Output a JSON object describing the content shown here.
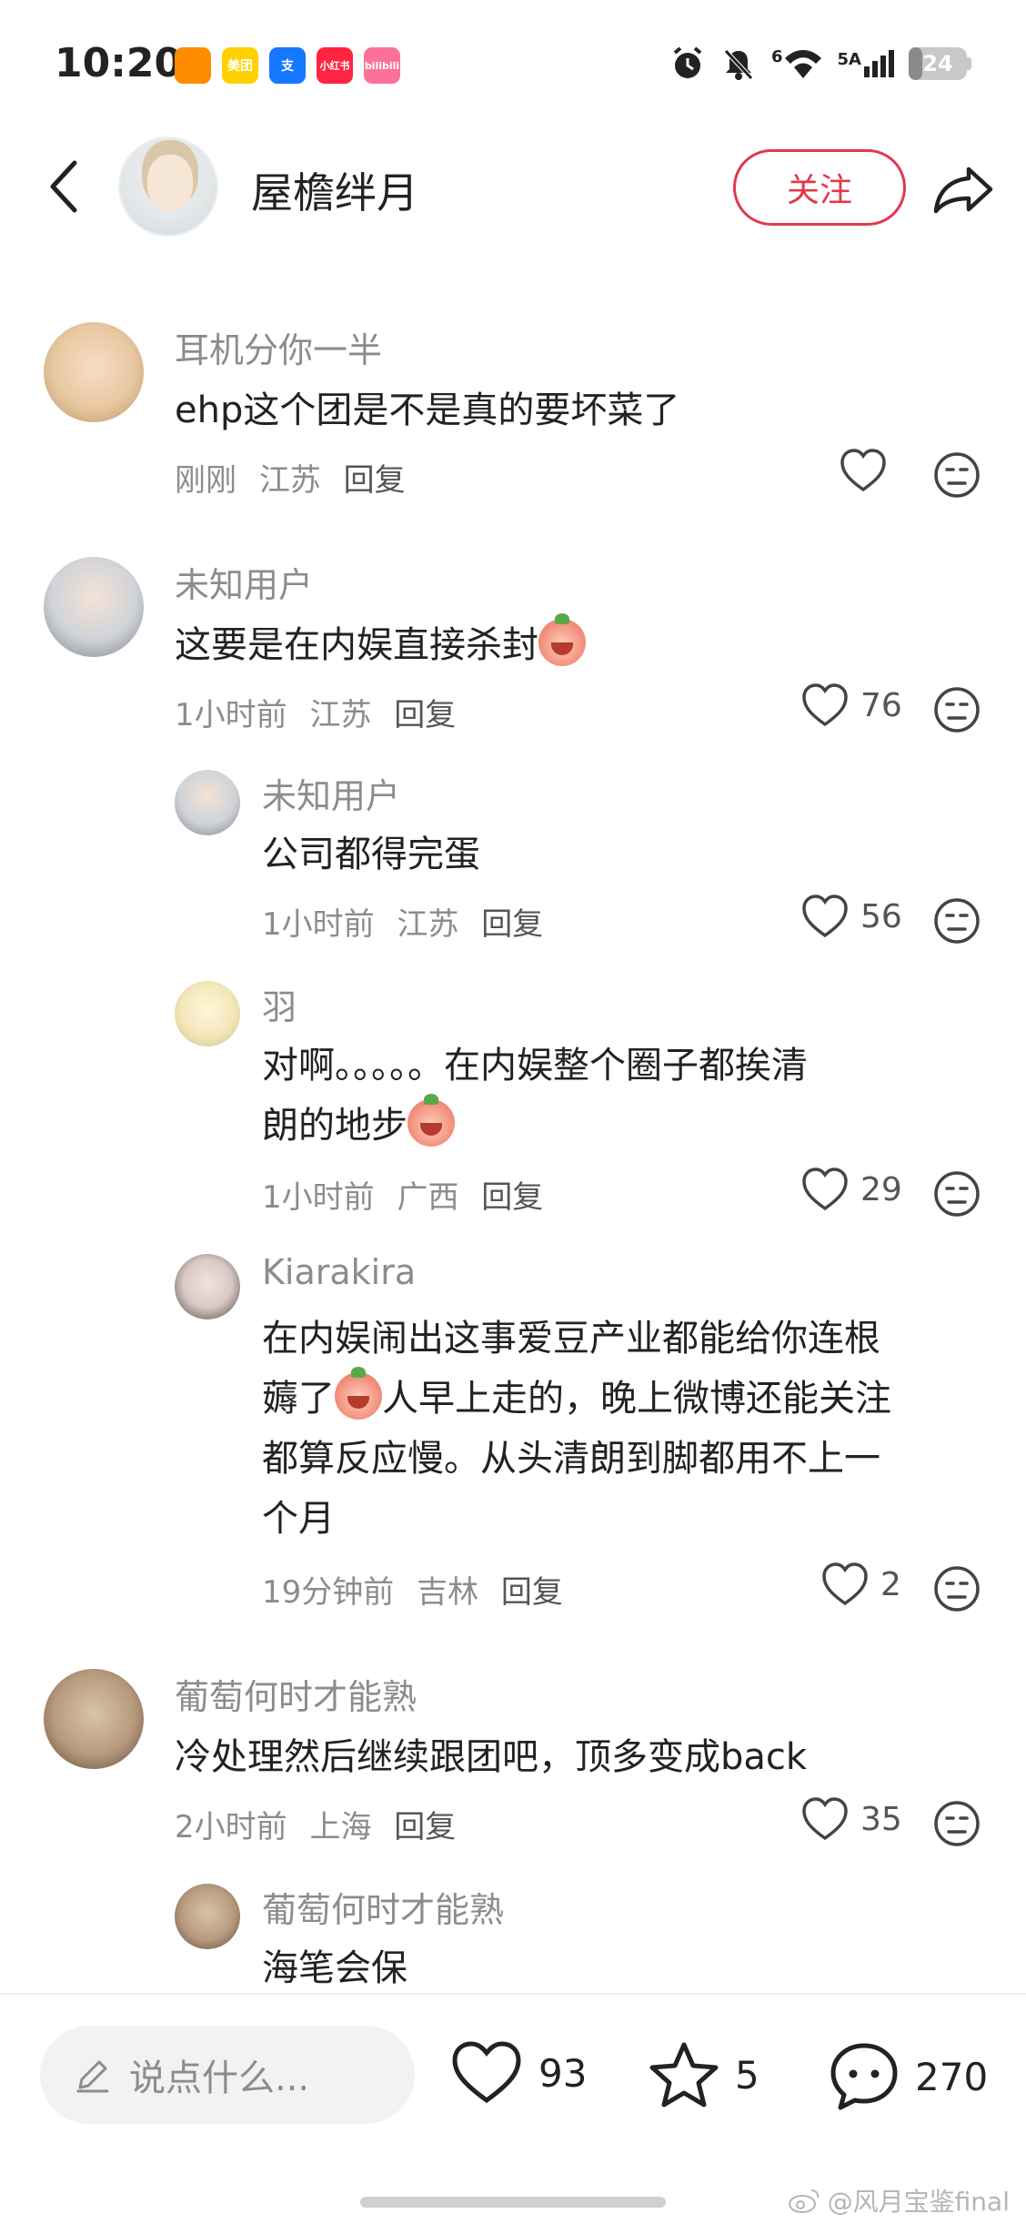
{
  "status_bar": {
    "time": "10:20",
    "network": "5A",
    "signal_prefix": "6",
    "battery": "24",
    "battery_level": 0.24,
    "apps": [
      {
        "name": "weibo-icon",
        "color": "#ff8c00",
        "label": ""
      },
      {
        "name": "meituan-icon",
        "color": "#ffd100",
        "label": "美团"
      },
      {
        "name": "alipay-icon",
        "color": "#1677ff",
        "label": "支"
      },
      {
        "name": "xiaohongshu-icon",
        "color": "#ff2442",
        "label": "小红书"
      },
      {
        "name": "bilibili-icon",
        "color": "#fb7299",
        "label": "bilibili"
      }
    ]
  },
  "header": {
    "author_name": "屋檐绊月",
    "follow_label": "关注"
  },
  "comments": [
    {
      "id": "c1",
      "username": "耳机分你一半",
      "text": "ehp这个团是不是真的要坏菜了",
      "time": "刚刚",
      "location": "江苏",
      "reply_label": "回复",
      "likes": "",
      "avatar_color": "#e9c8a0"
    },
    {
      "id": "c2",
      "username": "未知用户",
      "text": "这要是在内娱直接杀封",
      "has_emoji": true,
      "time": "1小时前",
      "location": "江苏",
      "reply_label": "回复",
      "likes": "76",
      "avatar_color": "#cfd3d8"
    },
    {
      "id": "c2r1",
      "username": "未知用户",
      "text": "公司都得完蛋",
      "time": "1小时前",
      "location": "江苏",
      "reply_label": "回复",
      "likes": "56",
      "avatar_color": "#cfd3d8"
    },
    {
      "id": "c2r2",
      "username": "羽",
      "text_lines": [
        "对啊。。。。。在内娱整个圈子都挨清",
        "朗的地步"
      ],
      "has_emoji": true,
      "time": "1小时前",
      "location": "广西",
      "reply_label": "回复",
      "likes": "29",
      "avatar_color": "#f3e7b8"
    },
    {
      "id": "c2r3",
      "username": "Kiarakira",
      "text_lines": [
        "在内娱闹出这事爱豆产业都能给你连根",
        "薅了",
        "人早上走的，晚上微博还能关注",
        "都算反应慢。从头清朗到脚都用不上一",
        "个月"
      ],
      "has_emoji": true,
      "time": "19分钟前",
      "location": "吉林",
      "reply_label": "回复",
      "likes": "2",
      "avatar_color": "#d9c9c4"
    },
    {
      "id": "c3",
      "username": "葡萄何时才能熟",
      "text": "冷处理然后继续跟团吧，顶多变成back",
      "time": "2小时前",
      "location": "上海",
      "reply_label": "回复",
      "likes": "35",
      "avatar_color": "#b79a7e"
    },
    {
      "id": "c3r1",
      "username": "葡萄何时才能熟",
      "text": "海笔会保",
      "avatar_color": "#b79a7e"
    }
  ],
  "bottom_bar": {
    "input_placeholder": "说点什么...",
    "likes": "93",
    "favorites": "5",
    "comments": "270"
  },
  "watermark": "@风月宝鉴final"
}
